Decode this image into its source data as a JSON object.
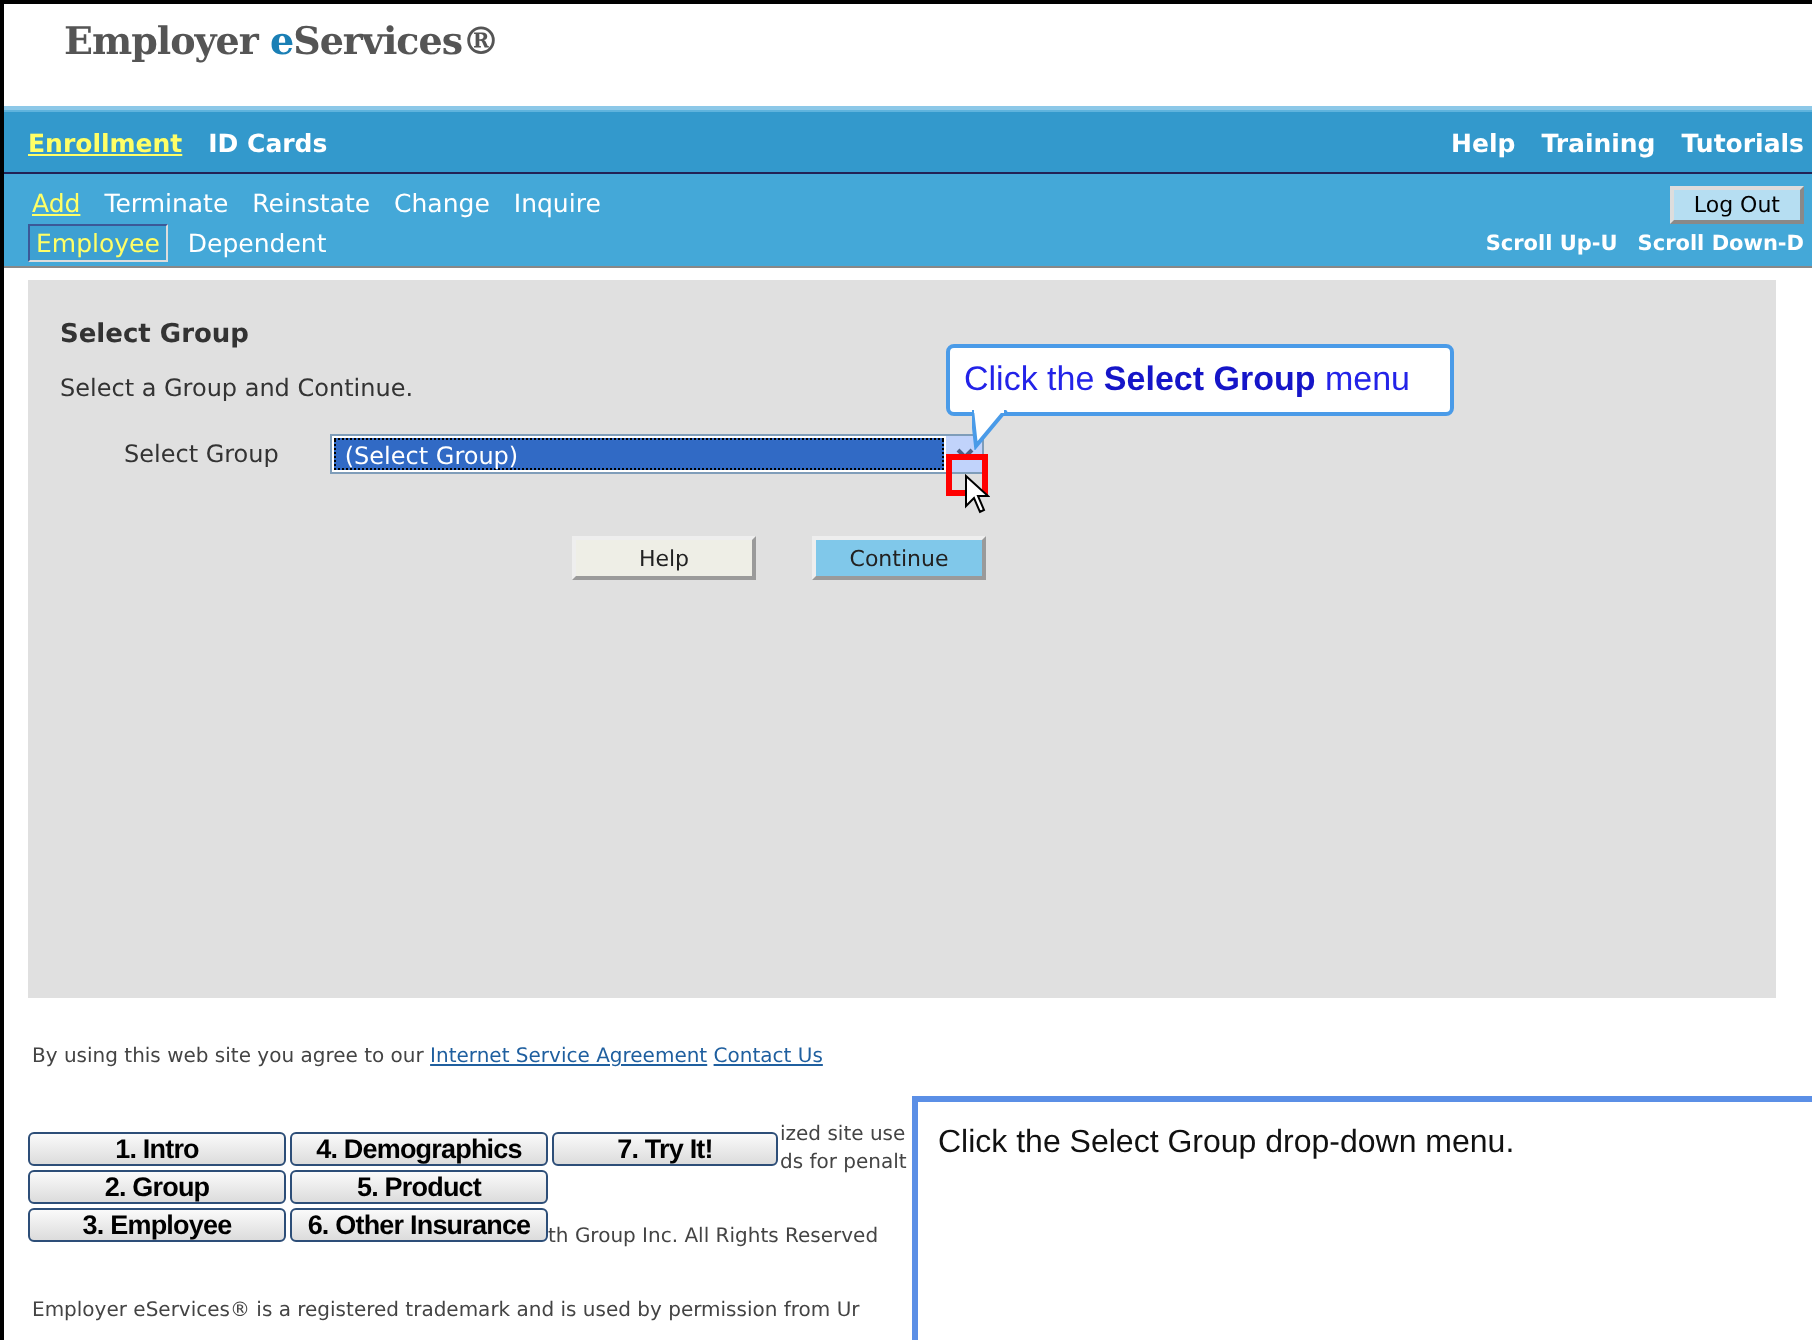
{
  "header": {
    "logo": [
      {
        "kind": "plain",
        "text": "Employer "
      },
      {
        "kind": "accent",
        "text": "e"
      },
      {
        "kind": "plain",
        "text": "Services®"
      }
    ]
  },
  "main_nav": {
    "left": [
      {
        "label": "Enrollment",
        "selected": true
      },
      {
        "label": "ID Cards",
        "selected": false
      }
    ],
    "right": [
      "Help",
      "Training",
      "Tutorials"
    ]
  },
  "action_nav": {
    "items": [
      {
        "label": "Add",
        "selected": true
      },
      {
        "label": "Terminate",
        "selected": false
      },
      {
        "label": "Reinstate",
        "selected": false
      },
      {
        "label": "Change",
        "selected": false
      },
      {
        "label": "Inquire",
        "selected": false
      }
    ],
    "logout": "Log Out"
  },
  "type_nav": {
    "items": [
      {
        "label": "Employee",
        "selected": true
      },
      {
        "label": "Dependent",
        "selected": false
      }
    ],
    "scroll": [
      "Scroll Up-U",
      "Scroll Down-D"
    ]
  },
  "panel": {
    "title": "Select Group",
    "instruction": "Select a Group and Continue.",
    "field_label": "Select Group",
    "select_value": "(Select Group)",
    "buttons": [
      {
        "label": "Help",
        "kind": "plain"
      },
      {
        "label": "Continue",
        "kind": "primary"
      }
    ]
  },
  "callout": {
    "text": "Click the **Select Group** menu"
  },
  "footer": {
    "agreement": "By using this web site you agree to our",
    "links": [
      "Internet Service Agreement",
      "Contact Us"
    ],
    "fragments": [
      "ized site use",
      "ds for penalt",
      "th Group Inc. All Rights Reserved"
    ],
    "trademark": "Employer eServices® is a registered trademark and is used by permission from Ur"
  },
  "tutorial_nav": [
    "1. Intro",
    "2. Group",
    "3. Employee",
    "4. Demographics",
    "5. Product",
    "6. Other Insurance",
    "7. Try It!"
  ],
  "instruction_box": {
    "text": "Click the Select Group drop-down menu."
  }
}
